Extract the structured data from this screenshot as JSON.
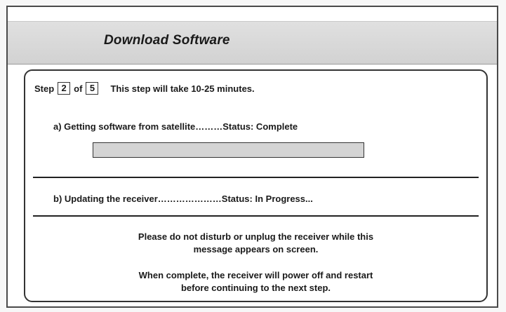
{
  "window": {
    "title": "Download Software"
  },
  "step": {
    "label": "Step",
    "current": "2",
    "of_label": "of",
    "total": "5",
    "duration_text": "This step will take 10-25 minutes."
  },
  "tasks": [
    {
      "text": "a) Getting software from satellite………Status:  Complete",
      "progress": 1.0
    },
    {
      "text": "b) Updating the receiver…………………Status:  In Progress..."
    }
  ],
  "messages": {
    "warning_line1": "Please do not disturb or unplug the receiver while this",
    "warning_line2": "message appears on screen.",
    "info_line1": "When complete, the receiver will power off and restart",
    "info_line2": "before continuing to the next step."
  },
  "colors": {
    "header_band": "#d8d8d8",
    "progress_fill": "#d4d4d4",
    "border": "#333333"
  }
}
